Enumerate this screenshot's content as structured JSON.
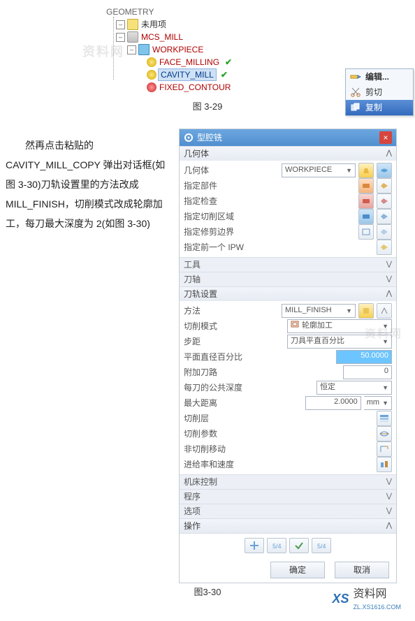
{
  "figure_top": "图 3-29",
  "figure_bottom": "图3-30",
  "paragraph": "然再点击粘贴的 CAVITY_MILL_COPY 弹出对话框(如图 3-30)刀轨设置里的方法改成 MILL_FINISH，切削模式改成轮廓加工，每刀最大深度为 2(如图 3-30)",
  "watermark": "资料网",
  "footer": {
    "brand": "XS",
    "label": "资料网",
    "url": "ZL.XS1616.COM"
  },
  "tree": {
    "root": "GEOMETRY",
    "n1": "未用项",
    "n2": "MCS_MILL",
    "n3": "WORKPIECE",
    "n3a": "FACE_MILLING",
    "n3b": "CAVITY_MILL",
    "n3c": "FIXED_CONTOUR"
  },
  "ctx": {
    "edit": "编辑...",
    "cut": "剪切",
    "copy": "复制"
  },
  "dlg": {
    "title": "型腔铣",
    "sec_geom": "几何体",
    "geom_label": "几何体",
    "geom_value": "WORKPIECE",
    "r_part": "指定部件",
    "r_blank": "指定检查",
    "r_cutarea": "指定切削区域",
    "r_trim": "指定修剪边界",
    "r_ipw": "指定前一个 IPW",
    "sec_tool": "工具",
    "sec_axis": "刀轴",
    "sec_path": "刀轨设置",
    "method_lbl": "方法",
    "method_val": "MILL_FINISH",
    "cutmode_lbl": "切削模式",
    "cutmode_val": "轮廓加工",
    "cutmode_ico": "跟",
    "step_lbl": "步距",
    "step_val": "刀具平直百分比",
    "pdia_lbl": "平面直径百分比",
    "pdia_val": "50.0000",
    "addpass_lbl": "附加刀路",
    "addpass_val": "0",
    "publicdepth_lbl": "每刀的公共深度",
    "publicdepth_val": "恒定",
    "maxdist_lbl": "最大距离",
    "maxdist_val": "2.0000",
    "maxdist_unit": "mm",
    "r_cutlayer": "切削层",
    "r_cutparam": "切削参数",
    "r_noncut": "非切削移动",
    "r_feedspeed": "进给率和速度",
    "sec_mc": "机床控制",
    "sec_prog": "程序",
    "sec_opt": "选项",
    "sec_act": "操作",
    "ok": "确定",
    "cancel": "取消"
  }
}
